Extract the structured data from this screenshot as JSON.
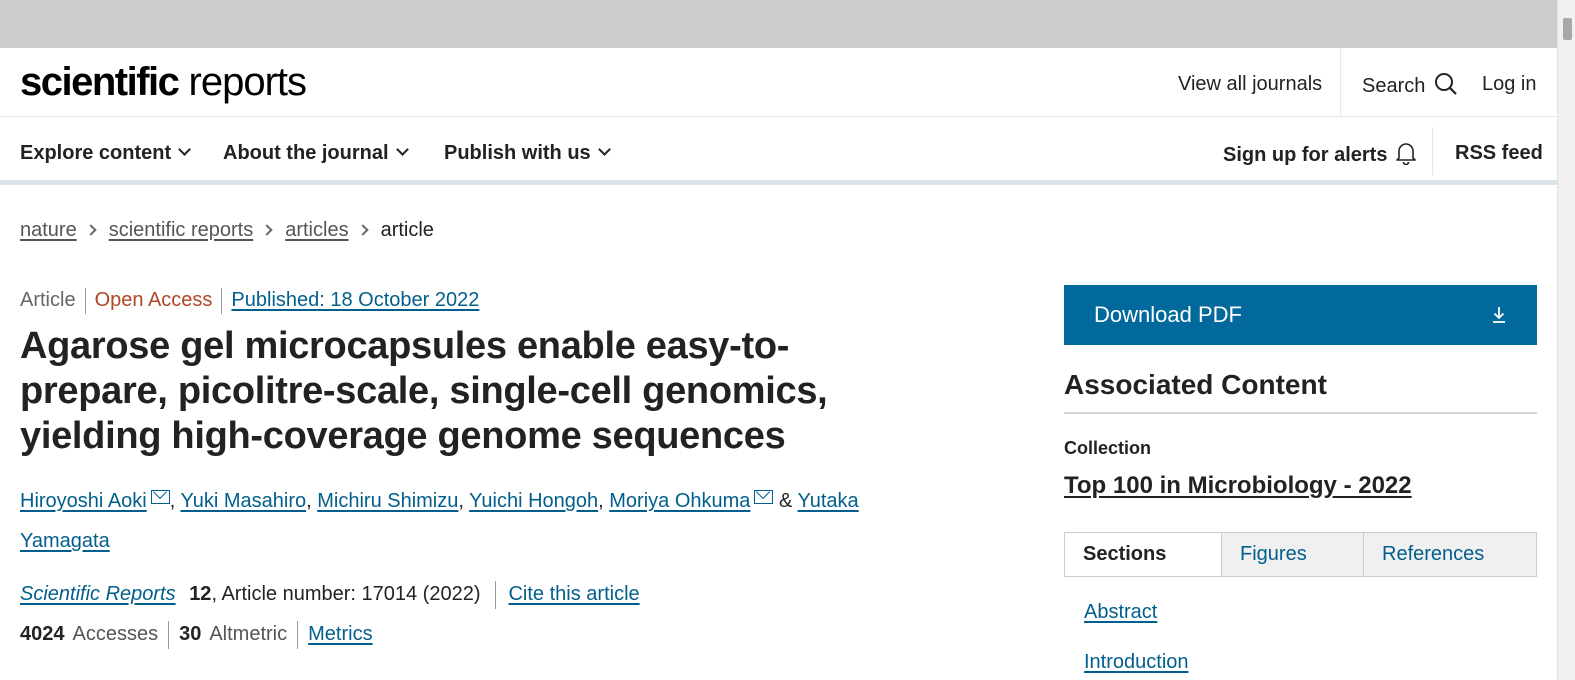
{
  "header": {
    "logo_bold": "scientific",
    "logo_light": "reports",
    "view_all": "View all journals",
    "search": "Search",
    "login": "Log in"
  },
  "nav": {
    "explore": "Explore content",
    "about": "About the journal",
    "publish": "Publish with us",
    "alerts": "Sign up for alerts",
    "rss": "RSS feed"
  },
  "breadcrumb": {
    "items": [
      "nature",
      "scientific reports",
      "articles"
    ],
    "current": "article"
  },
  "article": {
    "type": "Article",
    "access": "Open Access",
    "published": "Published: 18 October 2022",
    "title": "Agarose gel microcapsules enable easy-to-prepare, picolitre-scale, single-cell genomics, yielding high-coverage genome sequences",
    "authors": [
      "Hiroyoshi Aoki",
      "Yuki Masahiro",
      "Michiru Shimizu",
      "Yuichi Hongoh",
      "Moriya Ohkuma",
      "Yutaka Yamagata"
    ],
    "journal": "Scientific Reports",
    "volume": "12",
    "article_number": ", Article number: 17014 (2022)",
    "cite": "Cite this article",
    "accesses_count": "4024",
    "accesses_label": "Accesses",
    "altmetric_count": "30",
    "altmetric_label": "Altmetric",
    "metrics": "Metrics"
  },
  "sidebar": {
    "download": "Download PDF",
    "assoc_title": "Associated Content",
    "collection_label": "Collection",
    "collection_link": "Top 100 in Microbiology - 2022",
    "tabs": [
      "Sections",
      "Figures",
      "References"
    ],
    "sections": [
      "Abstract",
      "Introduction"
    ]
  },
  "colors": {
    "link": "#025e8d",
    "open_access": "#b04624",
    "download_bg": "#01699b",
    "top_bar": "#cccccc"
  }
}
